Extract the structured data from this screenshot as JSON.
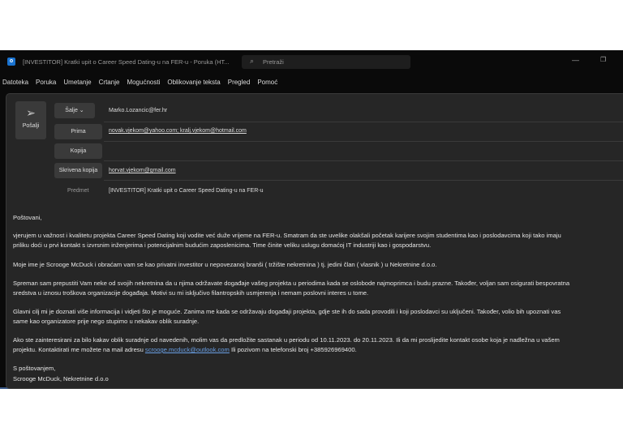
{
  "window": {
    "title": "[INVESTITOR] Kratki upit o Career Speed Dating-u na FER-u  -  Poruka (HT...",
    "search_placeholder": "Pretraži",
    "app_icon": "outlook-icon"
  },
  "menu": [
    "Datoteka",
    "Poruka",
    "Umetanje",
    "Crtanje",
    "Mogućnosti",
    "Oblikovanje teksta",
    "Pregled",
    "Pomoć"
  ],
  "header": {
    "send_label": "Pošalji",
    "from_label": "Šalje ⌄",
    "from_value": "Marko.Lozancic@fer.hr",
    "to_label": "Prima",
    "to_value": "novak.vjekom@yahoo.com; kralj.vjekom@hotmail.com",
    "cc_label": "Kopija",
    "cc_value": "",
    "bcc_label": "Skrivena kopija",
    "bcc_value": "horvat.vjekom@gmail.com",
    "subject_label": "Predmet",
    "subject_value": "[INVESTITOR]  Kratki upit o Career Speed Dating-u na FER-u"
  },
  "body": {
    "greeting": "Poštovani,",
    "p1": [
      "vjerujem u važnost i kvalitetu projekta Career Speed Dating koji vodite već duže vrijeme na FER-u. Smatram da ste uvelike olakšali početak karijere svojim studentima kao i poslodavcima koji tako imaju",
      "priliku doći u prvi kontakt s izvrsnim inženjerima i potencijalnim budućim zaposlenicima. Time činite veliku uslugu domaćoj IT industriji kao i gospodarstvu."
    ],
    "p2": [
      "Moje ime je Scrooge McDuck i obraćam vam se kao privatni investitor u nepovezanoj branši ( tržište nekretnina ) tj. jedini član ( vlasnik ) u Nekretnine d.o.o."
    ],
    "p3": [
      "Spreman sam prepustiti Vam neke od svojih nekretnina da u njima održavate događaje vašeg projekta u periodima kada se oslobode najmoprimca i budu prazne. Također, voljan sam osigurati bespovratna",
      "sredstva u iznosu troškova organizacije događaja. Motivi su mi isključivo filantropskih usmjerenja i nemam poslovni interes u tome."
    ],
    "p4": [
      "Glavni cilj mi je doznati više informacija i vidjeti što je moguće. Zanima me kada se održavaju događaji projekta, gdje ste ih do sada provodili i koji poslodavci su uključeni. Također, volio bih upoznati vas",
      "same kao organizatore prije nego stupimo u nekakav oblik suradnje."
    ],
    "p5_line1": "Ako ste zainteresirani za bilo kakav oblik suradnje od navedenih, molim vas da predložite sastanak u periodu od 10.11.2023. do 20.11.2023. Ili da mi proslijedite kontakt osobe koja je nadležna u vašem",
    "p5_line2_pre": "projektu. Kontaktirati me možete na mail adresu ",
    "p5_link": "scrooge.mcduck@outlook.com",
    "p5_line2_post": " Ili pozivom na telefonski broj +385926969400.",
    "closing": "S poštovanjem,",
    "signature": "Scrooge McDuck, Nekretnine d.o.o"
  }
}
